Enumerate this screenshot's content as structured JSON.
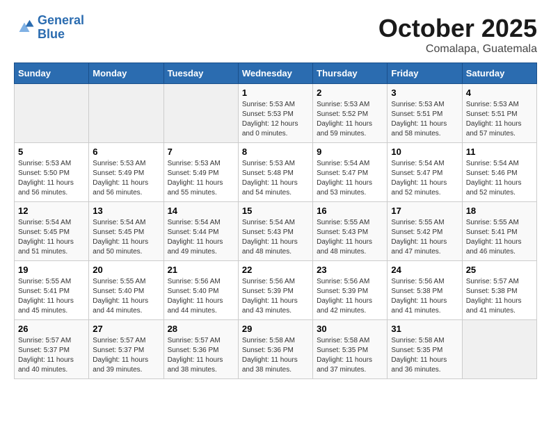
{
  "header": {
    "logo_line1": "General",
    "logo_line2": "Blue",
    "month": "October 2025",
    "location": "Comalapa, Guatemala"
  },
  "weekdays": [
    "Sunday",
    "Monday",
    "Tuesday",
    "Wednesday",
    "Thursday",
    "Friday",
    "Saturday"
  ],
  "weeks": [
    [
      {
        "day": "",
        "info": ""
      },
      {
        "day": "",
        "info": ""
      },
      {
        "day": "",
        "info": ""
      },
      {
        "day": "1",
        "info": "Sunrise: 5:53 AM\nSunset: 5:53 PM\nDaylight: 12 hours\nand 0 minutes."
      },
      {
        "day": "2",
        "info": "Sunrise: 5:53 AM\nSunset: 5:52 PM\nDaylight: 11 hours\nand 59 minutes."
      },
      {
        "day": "3",
        "info": "Sunrise: 5:53 AM\nSunset: 5:51 PM\nDaylight: 11 hours\nand 58 minutes."
      },
      {
        "day": "4",
        "info": "Sunrise: 5:53 AM\nSunset: 5:51 PM\nDaylight: 11 hours\nand 57 minutes."
      }
    ],
    [
      {
        "day": "5",
        "info": "Sunrise: 5:53 AM\nSunset: 5:50 PM\nDaylight: 11 hours\nand 56 minutes."
      },
      {
        "day": "6",
        "info": "Sunrise: 5:53 AM\nSunset: 5:49 PM\nDaylight: 11 hours\nand 56 minutes."
      },
      {
        "day": "7",
        "info": "Sunrise: 5:53 AM\nSunset: 5:49 PM\nDaylight: 11 hours\nand 55 minutes."
      },
      {
        "day": "8",
        "info": "Sunrise: 5:53 AM\nSunset: 5:48 PM\nDaylight: 11 hours\nand 54 minutes."
      },
      {
        "day": "9",
        "info": "Sunrise: 5:54 AM\nSunset: 5:47 PM\nDaylight: 11 hours\nand 53 minutes."
      },
      {
        "day": "10",
        "info": "Sunrise: 5:54 AM\nSunset: 5:47 PM\nDaylight: 11 hours\nand 52 minutes."
      },
      {
        "day": "11",
        "info": "Sunrise: 5:54 AM\nSunset: 5:46 PM\nDaylight: 11 hours\nand 52 minutes."
      }
    ],
    [
      {
        "day": "12",
        "info": "Sunrise: 5:54 AM\nSunset: 5:45 PM\nDaylight: 11 hours\nand 51 minutes."
      },
      {
        "day": "13",
        "info": "Sunrise: 5:54 AM\nSunset: 5:45 PM\nDaylight: 11 hours\nand 50 minutes."
      },
      {
        "day": "14",
        "info": "Sunrise: 5:54 AM\nSunset: 5:44 PM\nDaylight: 11 hours\nand 49 minutes."
      },
      {
        "day": "15",
        "info": "Sunrise: 5:54 AM\nSunset: 5:43 PM\nDaylight: 11 hours\nand 48 minutes."
      },
      {
        "day": "16",
        "info": "Sunrise: 5:55 AM\nSunset: 5:43 PM\nDaylight: 11 hours\nand 48 minutes."
      },
      {
        "day": "17",
        "info": "Sunrise: 5:55 AM\nSunset: 5:42 PM\nDaylight: 11 hours\nand 47 minutes."
      },
      {
        "day": "18",
        "info": "Sunrise: 5:55 AM\nSunset: 5:41 PM\nDaylight: 11 hours\nand 46 minutes."
      }
    ],
    [
      {
        "day": "19",
        "info": "Sunrise: 5:55 AM\nSunset: 5:41 PM\nDaylight: 11 hours\nand 45 minutes."
      },
      {
        "day": "20",
        "info": "Sunrise: 5:55 AM\nSunset: 5:40 PM\nDaylight: 11 hours\nand 44 minutes."
      },
      {
        "day": "21",
        "info": "Sunrise: 5:56 AM\nSunset: 5:40 PM\nDaylight: 11 hours\nand 44 minutes."
      },
      {
        "day": "22",
        "info": "Sunrise: 5:56 AM\nSunset: 5:39 PM\nDaylight: 11 hours\nand 43 minutes."
      },
      {
        "day": "23",
        "info": "Sunrise: 5:56 AM\nSunset: 5:39 PM\nDaylight: 11 hours\nand 42 minutes."
      },
      {
        "day": "24",
        "info": "Sunrise: 5:56 AM\nSunset: 5:38 PM\nDaylight: 11 hours\nand 41 minutes."
      },
      {
        "day": "25",
        "info": "Sunrise: 5:57 AM\nSunset: 5:38 PM\nDaylight: 11 hours\nand 41 minutes."
      }
    ],
    [
      {
        "day": "26",
        "info": "Sunrise: 5:57 AM\nSunset: 5:37 PM\nDaylight: 11 hours\nand 40 minutes."
      },
      {
        "day": "27",
        "info": "Sunrise: 5:57 AM\nSunset: 5:37 PM\nDaylight: 11 hours\nand 39 minutes."
      },
      {
        "day": "28",
        "info": "Sunrise: 5:57 AM\nSunset: 5:36 PM\nDaylight: 11 hours\nand 38 minutes."
      },
      {
        "day": "29",
        "info": "Sunrise: 5:58 AM\nSunset: 5:36 PM\nDaylight: 11 hours\nand 38 minutes."
      },
      {
        "day": "30",
        "info": "Sunrise: 5:58 AM\nSunset: 5:35 PM\nDaylight: 11 hours\nand 37 minutes."
      },
      {
        "day": "31",
        "info": "Sunrise: 5:58 AM\nSunset: 5:35 PM\nDaylight: 11 hours\nand 36 minutes."
      },
      {
        "day": "",
        "info": ""
      }
    ]
  ]
}
